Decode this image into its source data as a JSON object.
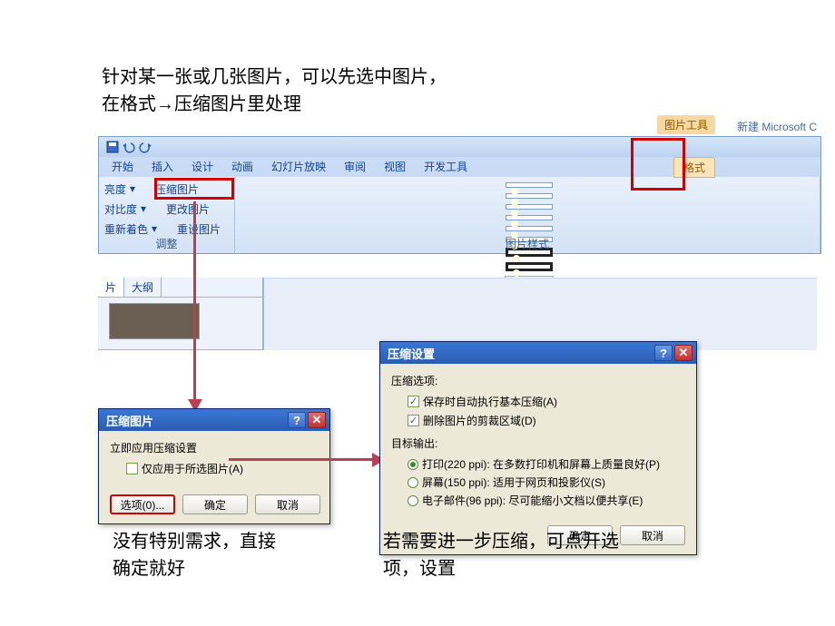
{
  "instructions": {
    "top_line1": "针对某一张或几张图片，可以先选中图片，",
    "top_line2": "在格式→压缩图片里处理",
    "bottom_left_line1": "没有特别需求，直接",
    "bottom_left_line2": "确定就好",
    "bottom_right_line1": "若需要进一步压缩，可点开选",
    "bottom_right_line2": "项，设置"
  },
  "ribbon": {
    "title_suffix": "新建 Microsoft C",
    "context_group": "图片工具",
    "tabs": [
      "开始",
      "插入",
      "设计",
      "动画",
      "幻灯片放映",
      "审阅",
      "视图",
      "开发工具"
    ],
    "context_tab": "格式",
    "adjust": {
      "brightness": "亮度",
      "contrast": "对比度",
      "recolor": "重新着色",
      "compress": "压缩图片",
      "change": "更改图片",
      "reset": "重设图片",
      "group_label": "调整"
    },
    "styles_group_label": "图片样式"
  },
  "slides_pane": {
    "tab_slides": "片",
    "tab_outline": "大纲"
  },
  "dialog1": {
    "title": "压缩图片",
    "heading": "立即应用压缩设置",
    "checkbox_apply_selected": "仅应用于所选图片(A)",
    "btn_options": "选项(0)...",
    "btn_ok": "确定",
    "btn_cancel": "取消"
  },
  "dialog2": {
    "title": "压缩设置",
    "section_compress": "压缩选项:",
    "chk_auto": "保存时自动执行基本压缩(A)",
    "chk_crop": "删除图片的剪裁区域(D)",
    "section_target": "目标输出:",
    "radio_print": "打印(220 ppi): 在多数打印机和屏幕上质量良好(P)",
    "radio_screen": "屏幕(150 ppi): 适用于网页和投影仪(S)",
    "radio_email": "电子邮件(96 ppi): 尽可能缩小文档以便共享(E)",
    "btn_ok": "确定",
    "btn_cancel": "取消"
  }
}
